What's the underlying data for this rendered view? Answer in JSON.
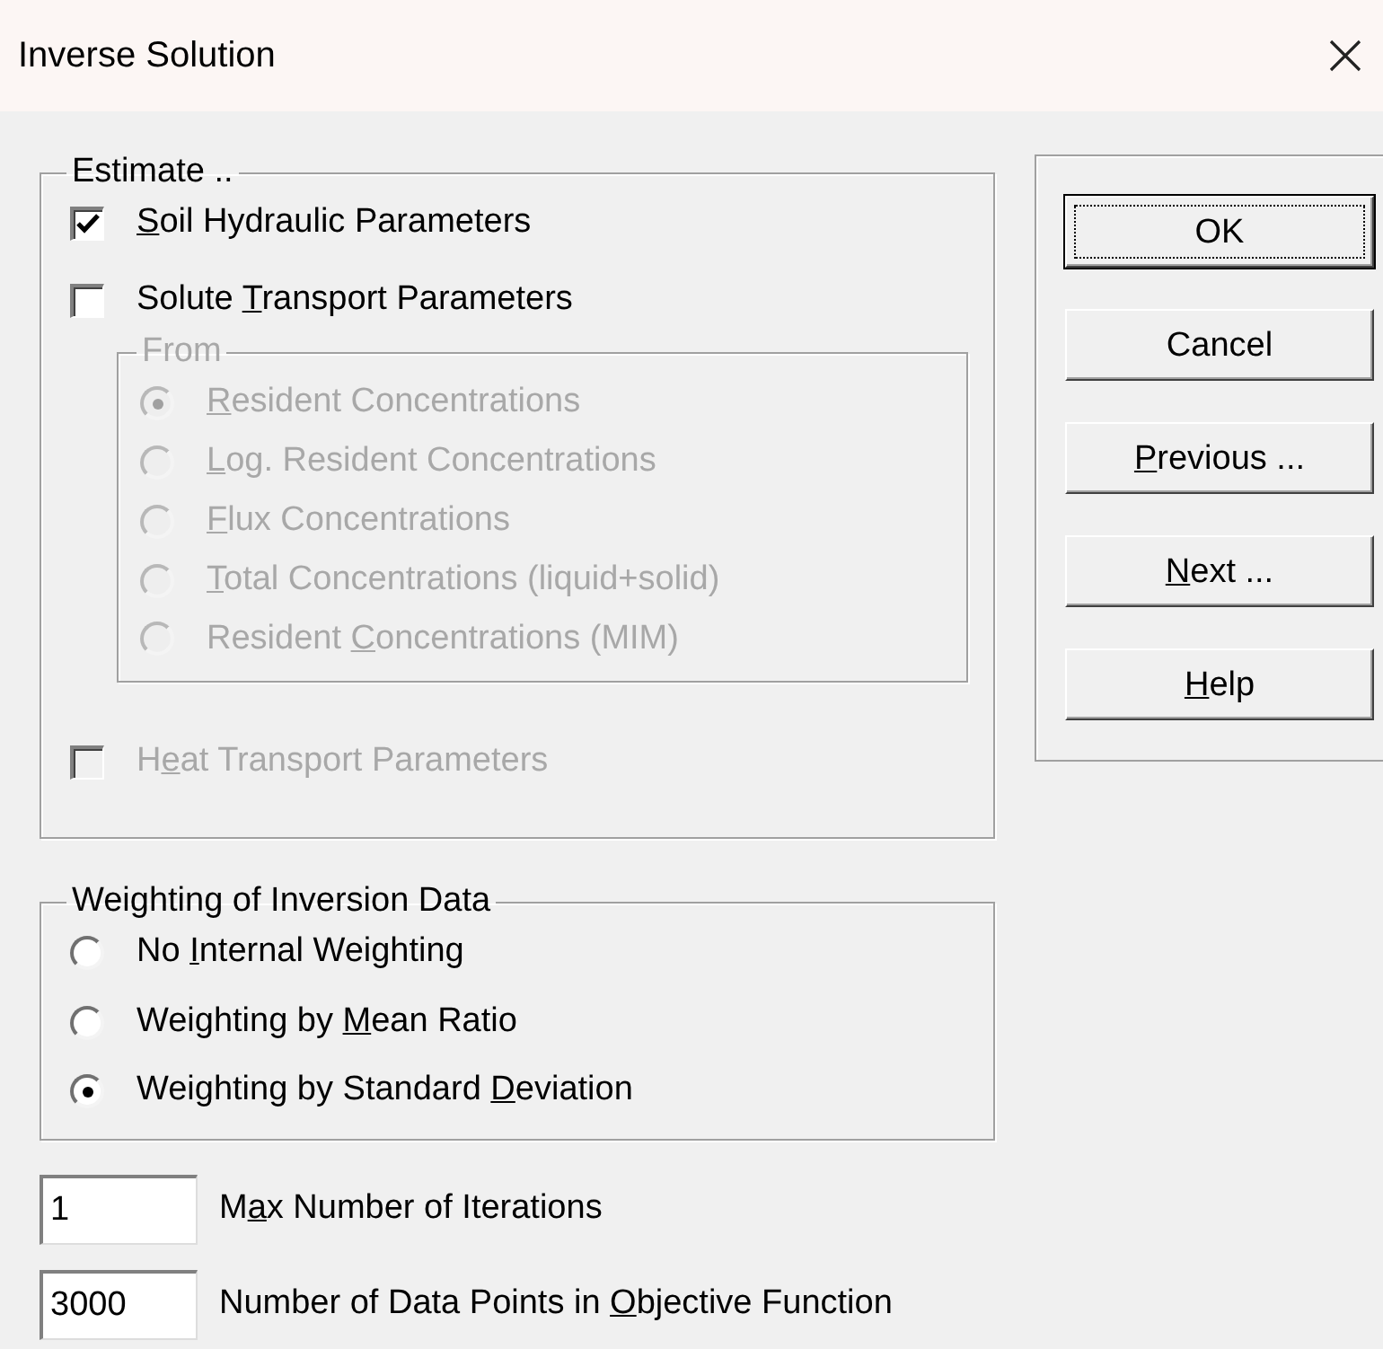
{
  "window": {
    "title": "Inverse Solution"
  },
  "estimate": {
    "legend": "Estimate ..",
    "items": [
      {
        "kind": "checkbox",
        "label": {
          "key": "S",
          "post": "oil Hydraulic Parameters"
        },
        "checked": true,
        "disabled": false
      },
      {
        "kind": "checkbox",
        "label": {
          "pre": "Solute ",
          "key": "T",
          "post": "ransport Parameters"
        },
        "checked": false,
        "disabled": false
      },
      {
        "kind": "group",
        "legend": "From",
        "disabled": true,
        "options": [
          {
            "label": {
              "key": "R",
              "post": "esident Concentrations"
            },
            "selected": true
          },
          {
            "label": {
              "key": "L",
              "post": "og. Resident Concentrations"
            },
            "selected": false
          },
          {
            "label": {
              "key": "F",
              "post": "lux Concentrations"
            },
            "selected": false
          },
          {
            "label": {
              "key": "T",
              "post": "otal Concentrations (liquid+solid)"
            },
            "selected": false
          },
          {
            "label": {
              "pre": "Resident ",
              "key": "C",
              "post": "oncentrations (MIM)"
            },
            "selected": false
          }
        ]
      },
      {
        "kind": "checkbox",
        "label": {
          "pre": "H",
          "key": "e",
          "post": "at Transport Parameters"
        },
        "checked": false,
        "disabled": true
      }
    ]
  },
  "weighting": {
    "legend": "Weighting of Inversion Data",
    "options": [
      {
        "label": {
          "pre": "No ",
          "key": "I",
          "post": "nternal Weighting"
        },
        "selected": false
      },
      {
        "label": {
          "pre": "Weighting by ",
          "key": "M",
          "post": "ean Ratio"
        },
        "selected": false
      },
      {
        "label": {
          "pre": "Weighting by Standard ",
          "key": "D",
          "post": "eviation"
        },
        "selected": true
      }
    ]
  },
  "fields": [
    {
      "value": "1",
      "label": {
        "pre": "M",
        "key": "a",
        "post": "x Number of Iterations"
      }
    },
    {
      "value": "3000",
      "label": {
        "pre": "Number of Data Points in ",
        "key": "O",
        "post": "bjective Function"
      }
    }
  ],
  "buttons": [
    {
      "label": {
        "pre": "OK"
      },
      "default": true
    },
    {
      "label": {
        "pre": "Cancel"
      },
      "default": false
    },
    {
      "label": {
        "key": "P",
        "post": "revious ..."
      },
      "default": false
    },
    {
      "label": {
        "key": "N",
        "post": "ext ..."
      },
      "default": false
    },
    {
      "label": {
        "key": "H",
        "post": "elp"
      },
      "default": false
    }
  ]
}
